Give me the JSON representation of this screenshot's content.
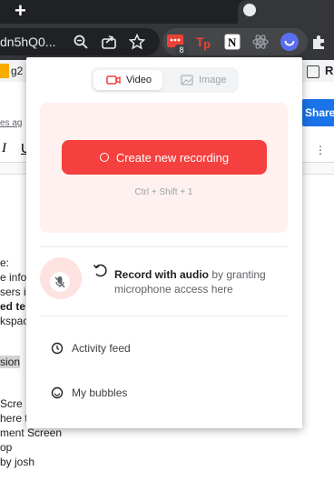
{
  "browser": {
    "url_fragment": "dn5hQ0...",
    "notification_badge": "8",
    "icons": [
      "zoom-icon",
      "share-icon",
      "bookmark-star-icon",
      "extension-notification-icon",
      "tp-extension-icon",
      "notion-extension-icon",
      "react-devtools-icon",
      "recorder-extension-icon",
      "puzzle-extensions-icon"
    ]
  },
  "docs_background": {
    "bookmark_text": "g2",
    "bookmark_right": "R",
    "subtitle_fragment": "es ag",
    "share_label": "Share",
    "format_italic": "I",
    "format_underline": "U",
    "lines": [
      {
        "text": "e:",
        "style": "normal"
      },
      {
        "text": "e infor",
        "style": "normal"
      },
      {
        "text": "sers i",
        "style": "normal"
      },
      {
        "text": "ed te",
        "style": "bold"
      },
      {
        "text": "kspac",
        "style": "normal"
      },
      {
        "text": "sion",
        "style": "highlight"
      },
      {
        "text": "Scre",
        "style": "normal"
      },
      {
        "text": "here te",
        "style": "normal"
      },
      {
        "text": "ment Screen",
        "style": "normal"
      },
      {
        "text": "op",
        "style": "normal"
      },
      {
        "text": "by josh",
        "style": "normal"
      }
    ]
  },
  "popup": {
    "tabs": {
      "video_label": "Video",
      "image_label": "Image",
      "selected": "Video"
    },
    "create_button_label": "Create new recording",
    "shortcut_hint": "Ctrl + Shift + 1",
    "audio": {
      "title": "Record with audio",
      "description": " by granting microphone access here"
    },
    "menu": [
      {
        "label": "Activity feed",
        "icon": "clock-icon"
      },
      {
        "label": "My bubbles",
        "icon": "bubble-icon"
      }
    ],
    "colors": {
      "accent": "#f4403e",
      "panel_bg": "#fff1ef",
      "mic_halo": "#fde2df"
    }
  }
}
